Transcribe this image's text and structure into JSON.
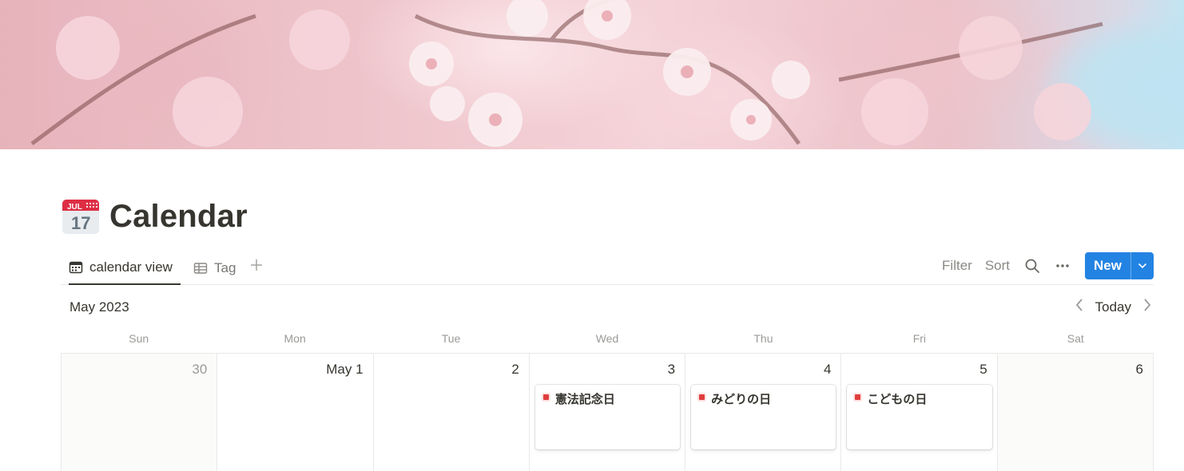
{
  "page": {
    "title": "Calendar",
    "icon": "calendar-page-icon",
    "icon_month_text": "JUL",
    "icon_day_text": "17"
  },
  "tabs": [
    {
      "label": "calendar view",
      "icon": "calendar-icon",
      "active": true
    },
    {
      "label": "Tag",
      "icon": "table-icon",
      "active": false
    }
  ],
  "toolbar": {
    "filter_label": "Filter",
    "sort_label": "Sort",
    "new_label": "New",
    "accent_color": "#2383e2"
  },
  "calendar": {
    "month_label": "May 2023",
    "today_label": "Today",
    "weekdays": [
      "Sun",
      "Mon",
      "Tue",
      "Wed",
      "Thu",
      "Fri",
      "Sat"
    ],
    "days": [
      {
        "label": "30",
        "outside": true,
        "weekend": true
      },
      {
        "label": "May 1",
        "outside": false,
        "weekend": false
      },
      {
        "label": "2",
        "outside": false,
        "weekend": false
      },
      {
        "label": "3",
        "outside": false,
        "weekend": false,
        "event": "憲法記念日"
      },
      {
        "label": "4",
        "outside": false,
        "weekend": false,
        "event": "みどりの日"
      },
      {
        "label": "5",
        "outside": false,
        "weekend": false,
        "event": "こどもの日"
      },
      {
        "label": "6",
        "outside": false,
        "weekend": true
      }
    ],
    "event_tag_color": "#e03e3e"
  }
}
